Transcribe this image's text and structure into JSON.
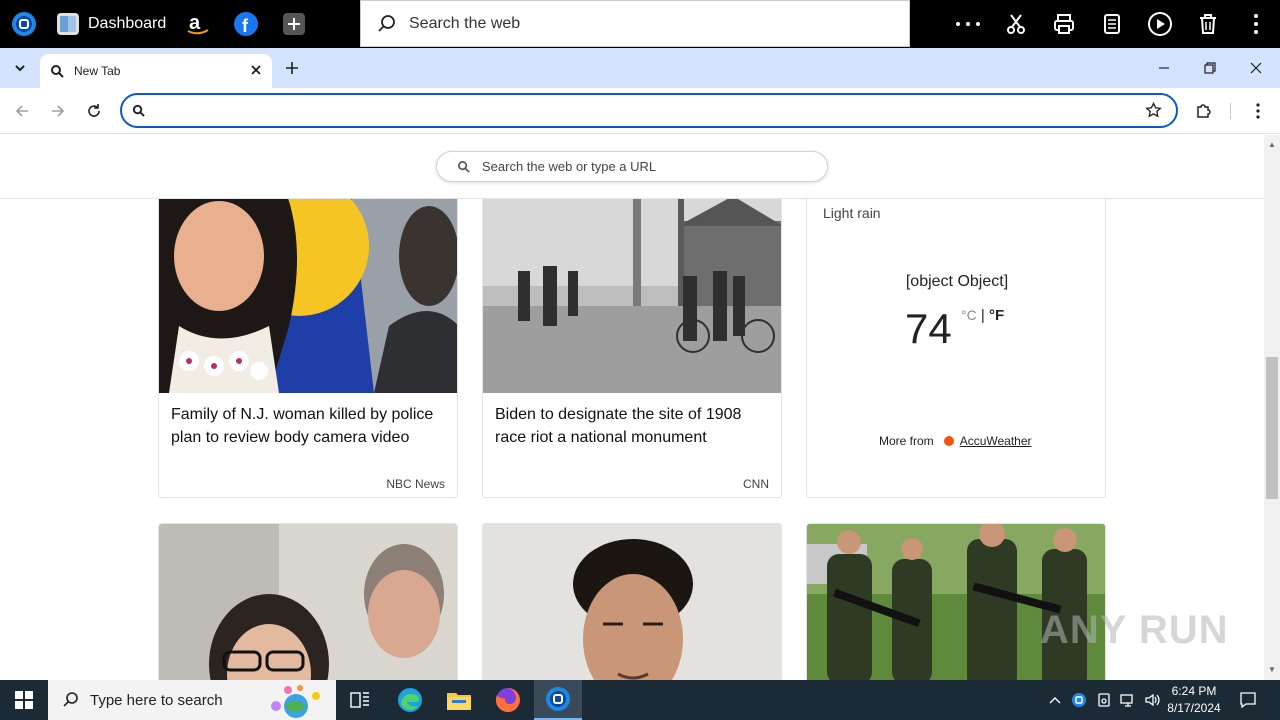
{
  "appbar": {
    "dashboard_label": "Dashboard",
    "search_placeholder": "Search the web"
  },
  "tab": {
    "title": "New Tab"
  },
  "omnibox": {
    "value": ""
  },
  "page_search": {
    "placeholder": "Search the web or type a URL"
  },
  "cards": [
    {
      "headline": "Family of N.J. woman killed by police plan to review body camera video",
      "source": "NBC News"
    },
    {
      "headline": "Biden to designate the site of 1908 race riot a national monument",
      "source": "CNN"
    }
  ],
  "weather": {
    "condition": "Light rain",
    "location": "[object Object]",
    "temperature": "74",
    "unit_c": "°C",
    "unit_sep": "|",
    "unit_f": "°F",
    "more_from": "More from",
    "brand": "AccuWeather"
  },
  "taskbar": {
    "search_placeholder": "Type here to search",
    "time": "6:24 PM",
    "date": "8/17/2024"
  },
  "watermark": "ANY RUN",
  "colors": {
    "accent": "#0b57d0",
    "tabstrip": "#d3e3fd",
    "taskbar": "#1c2a36",
    "accuweather": "#f05514"
  }
}
